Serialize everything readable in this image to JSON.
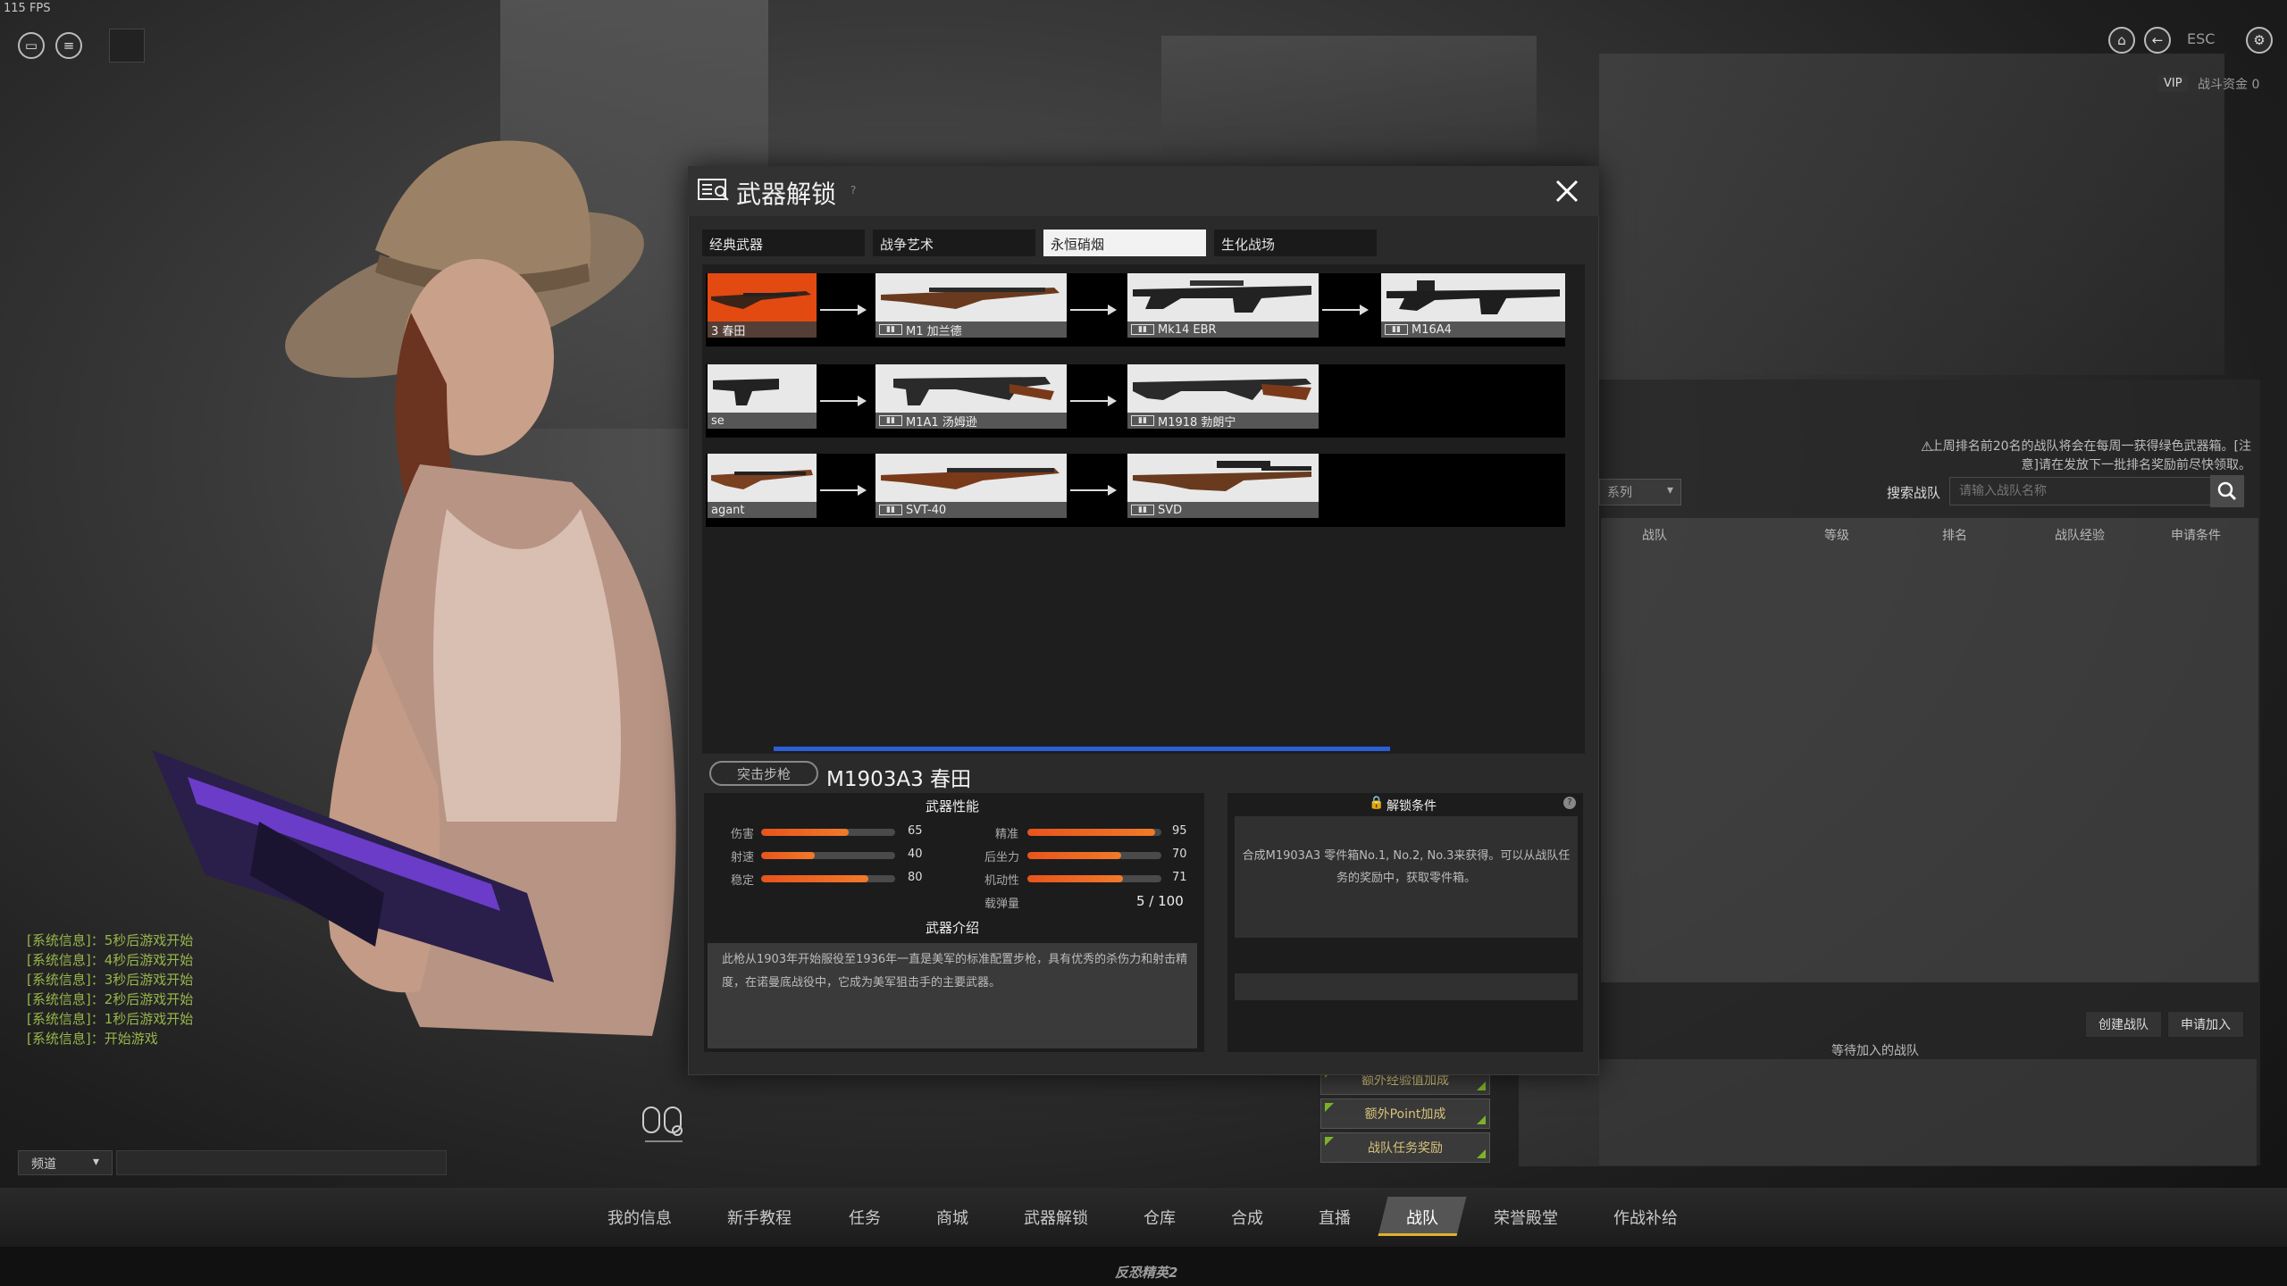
{
  "hud": {
    "fps": "115 FPS",
    "esc": "ESC",
    "vip": "VIP",
    "battle_fund": "战斗资金 0"
  },
  "modal": {
    "title": "武器解锁",
    "tabs": [
      {
        "label": "经典武器",
        "active": false
      },
      {
        "label": "战争艺术",
        "active": false
      },
      {
        "label": "永恒硝烟",
        "active": true
      },
      {
        "label": "生化战场",
        "active": false
      }
    ],
    "tree": [
      [
        "3 春田",
        "M1 加兰德",
        "Mk14 EBR",
        "M16A4"
      ],
      [
        "se",
        "M1A1 汤姆逊",
        "M1918 勃朗宁"
      ],
      [
        "agant",
        "SVT-40",
        "SVD"
      ]
    ],
    "selected": {
      "category": "突击步枪",
      "name": "M1903A3 春田"
    },
    "performance": {
      "title": "武器性能",
      "left": [
        {
          "label": "伤害",
          "value": "65",
          "pct": 0.65
        },
        {
          "label": "射速",
          "value": "40",
          "pct": 0.4
        },
        {
          "label": "稳定",
          "value": "80",
          "pct": 0.8
        }
      ],
      "right": [
        {
          "label": "精准",
          "value": "95",
          "pct": 0.95
        },
        {
          "label": "后坐力",
          "value": "70",
          "pct": 0.7
        },
        {
          "label": "机动性",
          "value": "71",
          "pct": 0.71
        }
      ],
      "ammo_label": "载弹量",
      "ammo_value": "5 / 100"
    },
    "intro": {
      "title": "武器介绍",
      "text": "此枪从1903年开始服役至1936年一直是美军的标准配置步枪，具有优秀的杀伤力和射击精度，在诺曼底战役中，它成为美军狙击手的主要武器。"
    },
    "unlock": {
      "title": "解锁条件",
      "text": "合成M1903A3 零件箱No.1, No.2, No.3来获得。可以从战队任务的奖励中，获取零件箱。"
    }
  },
  "team_panel": {
    "warning": "上周排名前20名的战队将会在每周一获得绿色武器箱。[注意]请在发放下一批排名奖励前尽快领取。",
    "filter": "系列",
    "search_label": "搜索战队",
    "search_placeholder": "请输入战队名称",
    "columns": [
      "战队",
      "等级",
      "排名",
      "战队经验",
      "申请条件"
    ],
    "create_btn": "创建战队",
    "apply_btn": "申请加入",
    "waiting": "等待加入的战队",
    "bonus": [
      "额外经验值加成",
      "额外Point加成",
      "战队任务奖励"
    ]
  },
  "chat": {
    "messages": [
      "[系统信息]：5秒后游戏开始",
      "[系统信息]：4秒后游戏开始",
      "[系统信息]：3秒后游戏开始",
      "[系统信息]：2秒后游戏开始",
      "[系统信息]：1秒后游戏开始",
      "[系统信息]：开始游戏"
    ],
    "channel": "频道"
  },
  "nav": {
    "items": [
      "我的信息",
      "新手教程",
      "任务",
      "商城",
      "武器解锁",
      "仓库",
      "合成",
      "直播",
      "战队",
      "荣誉殿堂",
      "作战补给"
    ],
    "active": "战队",
    "logo": "反恐精英2"
  },
  "colors": {
    "accent_orange": "#e8541c",
    "scroll_blue": "#2a5fd6",
    "chat_green": "#97b64a",
    "active_tab_underline": "#e0b030"
  }
}
